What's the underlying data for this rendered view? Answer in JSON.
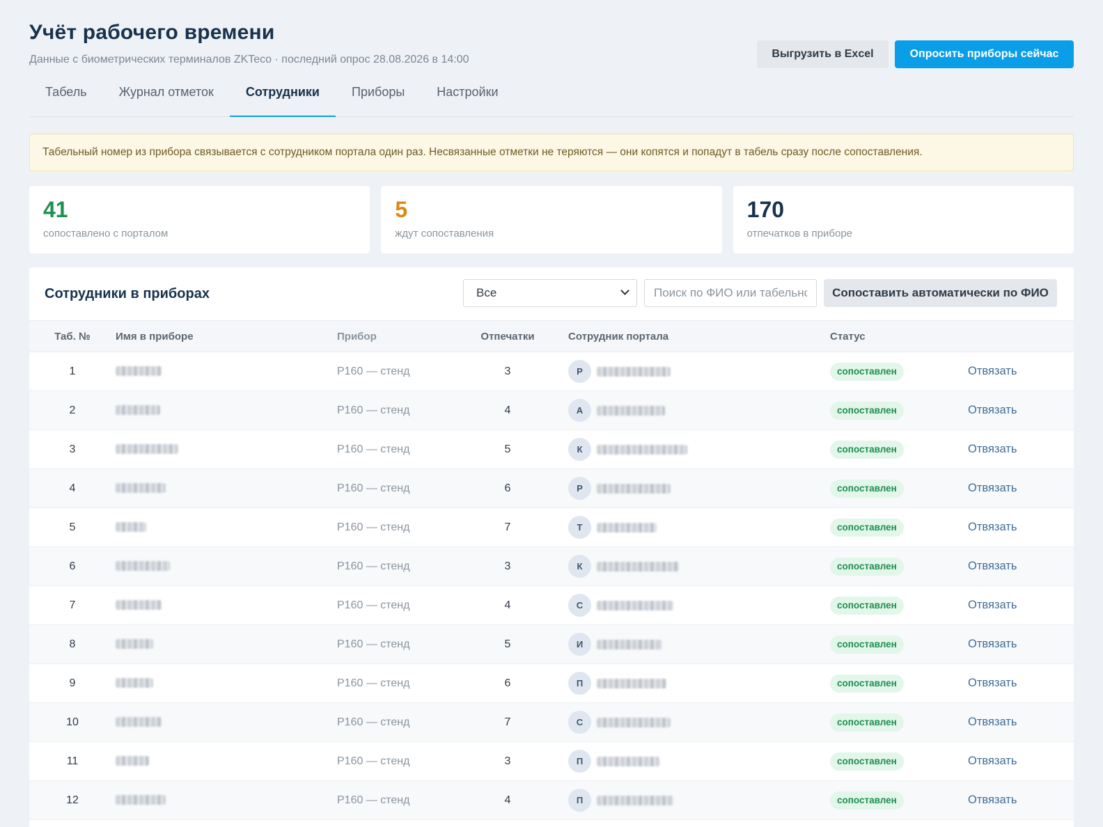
{
  "header": {
    "title": "Учёт рабочего времени",
    "subtitle": "Данные с биометрических терминалов ZKTeco · последний опрос 28.08.2026 в 14:00",
    "export_label": "Выгрузить в Excel",
    "poll_label": "Опросить приборы сейчас"
  },
  "tabs": [
    {
      "label": "Табель",
      "active": false
    },
    {
      "label": "Журнал отметок",
      "active": false
    },
    {
      "label": "Сотрудники",
      "active": true
    },
    {
      "label": "Приборы",
      "active": false
    },
    {
      "label": "Настройки",
      "active": false
    }
  ],
  "notice": "Табельный номер из прибора связывается с сотрудником портала один раз. Несвязанные отметки не теряются — они копятся и попадут в табель сразу после сопоставления.",
  "stats": [
    {
      "value": "41",
      "label": "сопоставлено с порталом",
      "color": "#1e9150"
    },
    {
      "value": "5",
      "label": "ждут сопоставления",
      "color": "#d98a13"
    },
    {
      "value": "170",
      "label": "отпечатков в приборе",
      "color": "#17324d"
    }
  ],
  "panel": {
    "title": "Сотрудники в приборах",
    "filter_value": "Все",
    "search_placeholder": "Поиск по ФИО или табельному",
    "auto_match_label": "Сопоставить автоматически по ФИО"
  },
  "table": {
    "columns": [
      "Таб. №",
      "Имя в приборе",
      "Прибор",
      "Отпечатки",
      "Сотрудник портала",
      "Статус",
      ""
    ],
    "rows": [
      {
        "no": "1",
        "device": "P160 — стенд",
        "fingerprints": "3",
        "initial": "Р",
        "status": "сопоставлен",
        "action": "Отвязать"
      },
      {
        "no": "2",
        "device": "P160 — стенд",
        "fingerprints": "4",
        "initial": "А",
        "status": "сопоставлен",
        "action": "Отвязать"
      },
      {
        "no": "3",
        "device": "P160 — стенд",
        "fingerprints": "5",
        "initial": "К",
        "status": "сопоставлен",
        "action": "Отвязать"
      },
      {
        "no": "4",
        "device": "P160 — стенд",
        "fingerprints": "6",
        "initial": "Р",
        "status": "сопоставлен",
        "action": "Отвязать"
      },
      {
        "no": "5",
        "device": "P160 — стенд",
        "fingerprints": "7",
        "initial": "Т",
        "status": "сопоставлен",
        "action": "Отвязать"
      },
      {
        "no": "6",
        "device": "P160 — стенд",
        "fingerprints": "3",
        "initial": "К",
        "status": "сопоставлен",
        "action": "Отвязать"
      },
      {
        "no": "7",
        "device": "P160 — стенд",
        "fingerprints": "4",
        "initial": "С",
        "status": "сопоставлен",
        "action": "Отвязать"
      },
      {
        "no": "8",
        "device": "P160 — стенд",
        "fingerprints": "5",
        "initial": "И",
        "status": "сопоставлен",
        "action": "Отвязать"
      },
      {
        "no": "9",
        "device": "P160 — стенд",
        "fingerprints": "6",
        "initial": "П",
        "status": "сопоставлен",
        "action": "Отвязать"
      },
      {
        "no": "10",
        "device": "P160 — стенд",
        "fingerprints": "7",
        "initial": "С",
        "status": "сопоставлен",
        "action": "Отвязать"
      },
      {
        "no": "11",
        "device": "P160 — стенд",
        "fingerprints": "3",
        "initial": "П",
        "status": "сопоставлен",
        "action": "Отвязать"
      },
      {
        "no": "12",
        "device": "P160 — стенд",
        "fingerprints": "4",
        "initial": "П",
        "status": "сопоставлен",
        "action": "Отвязать"
      }
    ]
  }
}
